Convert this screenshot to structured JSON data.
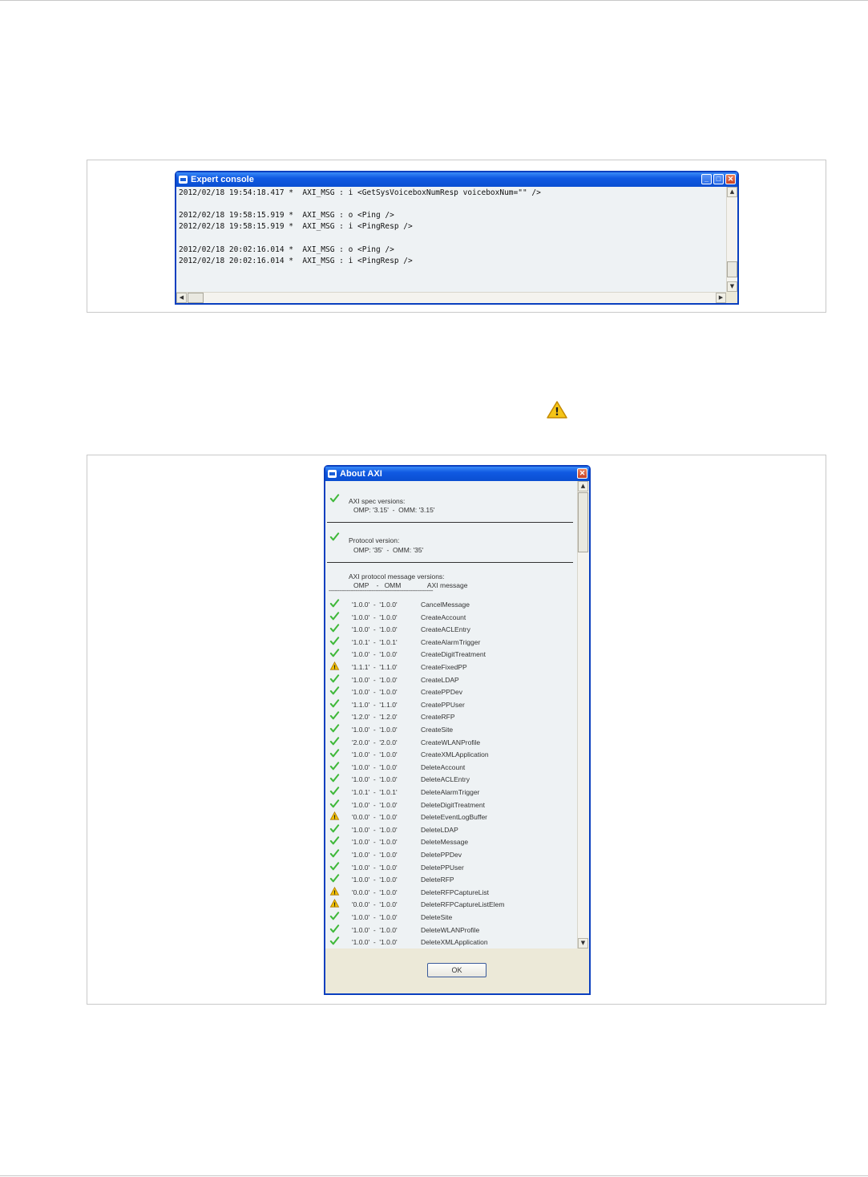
{
  "expert_console": {
    "title": "Expert console",
    "lines": [
      "2012/02/18 19:54:18.417 *  AXI_MSG : i <GetSysVoiceboxNumResp voiceboxNum=\"\" />",
      "",
      "2012/02/18 19:58:15.919 *  AXI_MSG : o <Ping />",
      "2012/02/18 19:58:15.919 *  AXI_MSG : i <PingResp />",
      "",
      "2012/02/18 20:02:16.014 *  AXI_MSG : o <Ping />",
      "2012/02/18 20:02:16.014 *  AXI_MSG : i <PingResp />"
    ]
  },
  "about_axi": {
    "title": "About AXI",
    "spec_versions": {
      "heading": "AXI spec versions:",
      "value": "OMP: '3.15'  -  OMM: '3.15'",
      "status": "ok"
    },
    "protocol_version": {
      "heading": "Protocol version:",
      "value": "OMP: '35'  -  OMM: '35'",
      "status": "ok"
    },
    "message_versions": {
      "heading": "AXI protocol message versions:",
      "columns_header": "OMP    -   OMM              AXI message",
      "separator": "-----------------------------------------------------------------------",
      "rows": [
        {
          "versions": "'1.0.0'  -  '1.0.0'",
          "message": "CancelMessage",
          "status": "ok"
        },
        {
          "versions": "'1.0.0'  -  '1.0.0'",
          "message": "CreateAccount",
          "status": "ok"
        },
        {
          "versions": "'1.0.0'  -  '1.0.0'",
          "message": "CreateACLEntry",
          "status": "ok"
        },
        {
          "versions": "'1.0.1'  -  '1.0.1'",
          "message": "CreateAlarmTrigger",
          "status": "ok"
        },
        {
          "versions": "'1.0.0'  -  '1.0.0'",
          "message": "CreateDigitTreatment",
          "status": "ok"
        },
        {
          "versions": "'1.1.1'  -  '1.1.0'",
          "message": "CreateFixedPP",
          "status": "warn"
        },
        {
          "versions": "'1.0.0'  -  '1.0.0'",
          "message": "CreateLDAP",
          "status": "ok"
        },
        {
          "versions": "'1.0.0'  -  '1.0.0'",
          "message": "CreatePPDev",
          "status": "ok"
        },
        {
          "versions": "'1.1.0'  -  '1.1.0'",
          "message": "CreatePPUser",
          "status": "ok"
        },
        {
          "versions": "'1.2.0'  -  '1.2.0'",
          "message": "CreateRFP",
          "status": "ok"
        },
        {
          "versions": "'1.0.0'  -  '1.0.0'",
          "message": "CreateSite",
          "status": "ok"
        },
        {
          "versions": "'2.0.0'  -  '2.0.0'",
          "message": "CreateWLANProfile",
          "status": "ok"
        },
        {
          "versions": "'1.0.0'  -  '1.0.0'",
          "message": "CreateXMLApplication",
          "status": "ok"
        },
        {
          "versions": "'1.0.0'  -  '1.0.0'",
          "message": "DeleteAccount",
          "status": "ok"
        },
        {
          "versions": "'1.0.0'  -  '1.0.0'",
          "message": "DeleteACLEntry",
          "status": "ok"
        },
        {
          "versions": "'1.0.1'  -  '1.0.1'",
          "message": "DeleteAlarmTrigger",
          "status": "ok"
        },
        {
          "versions": "'1.0.0'  -  '1.0.0'",
          "message": "DeleteDigitTreatment",
          "status": "ok"
        },
        {
          "versions": "'0.0.0'  -  '1.0.0'",
          "message": "DeleteEventLogBuffer",
          "status": "warn"
        },
        {
          "versions": "'1.0.0'  -  '1.0.0'",
          "message": "DeleteLDAP",
          "status": "ok"
        },
        {
          "versions": "'1.0.0'  -  '1.0.0'",
          "message": "DeleteMessage",
          "status": "ok"
        },
        {
          "versions": "'1.0.0'  -  '1.0.0'",
          "message": "DeletePPDev",
          "status": "ok"
        },
        {
          "versions": "'1.0.0'  -  '1.0.0'",
          "message": "DeletePPUser",
          "status": "ok"
        },
        {
          "versions": "'1.0.0'  -  '1.0.0'",
          "message": "DeleteRFP",
          "status": "ok"
        },
        {
          "versions": "'0.0.0'  -  '1.0.0'",
          "message": "DeleteRFPCaptureList",
          "status": "warn"
        },
        {
          "versions": "'0.0.0'  -  '1.0.0'",
          "message": "DeleteRFPCaptureListElem",
          "status": "warn"
        },
        {
          "versions": "'1.0.0'  -  '1.0.0'",
          "message": "DeleteSite",
          "status": "ok"
        },
        {
          "versions": "'1.0.0'  -  '1.0.0'",
          "message": "DeleteWLANProfile",
          "status": "ok"
        },
        {
          "versions": "'1.0.0'  -  '1.0.0'",
          "message": "DeleteXMLApplication",
          "status": "ok"
        }
      ]
    },
    "ok_label": "OK"
  },
  "icons": {
    "warning_glyph": "!",
    "ok_status_color": "#3fb83a",
    "warn_status_color": "#f2c200",
    "window_close": "✕",
    "window_minimize": "_",
    "window_maximize": "□",
    "scroll_up": "▲",
    "scroll_down": "▼",
    "scroll_left": "◀",
    "scroll_right": "▶"
  }
}
